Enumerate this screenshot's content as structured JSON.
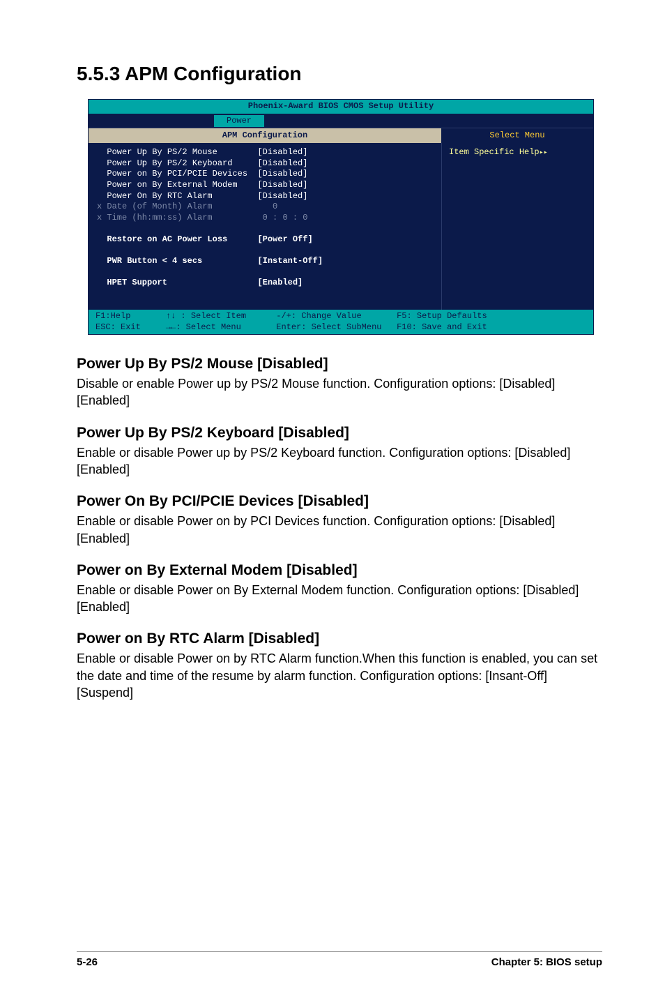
{
  "heading": "5.5.3   APM Configuration",
  "bios": {
    "title": "Phoenix-Award BIOS CMOS Setup Utility",
    "tab": "Power",
    "panel_title": "APM Configuration",
    "select_menu": "Select Menu",
    "help_title": "Item Specific Help",
    "rows": [
      {
        "prefix": "  ",
        "label": "Power Up By PS/2 Mouse",
        "value": "[Disabled]",
        "dim": false
      },
      {
        "prefix": "  ",
        "label": "Power Up By PS/2 Keyboard",
        "value": "[Disabled]",
        "dim": false
      },
      {
        "prefix": "  ",
        "label": "Power on By PCI/PCIE Devices",
        "value": "[Disabled]",
        "dim": false
      },
      {
        "prefix": "  ",
        "label": "Power on By External Modem",
        "value": "[Disabled]",
        "dim": false
      },
      {
        "prefix": "  ",
        "label": "Power On By RTC Alarm",
        "value": "[Disabled]",
        "dim": false
      },
      {
        "prefix": "x ",
        "label": "Date (of Month) Alarm",
        "value": "   0",
        "dim": true
      },
      {
        "prefix": "x ",
        "label": "Time (hh:mm:ss) Alarm",
        "value": " 0 : 0 : 0",
        "dim": true
      }
    ],
    "bold_rows": [
      {
        "label": "Restore on AC Power Loss",
        "value": "[Power Off]"
      },
      {
        "label": "PWR Button < 4 secs",
        "value": "[Instant-Off]"
      },
      {
        "label": "HPET Support",
        "value": "[Enabled]"
      }
    ],
    "footer": {
      "f1": "F1:Help",
      "updown": "↑↓ : Select Item",
      "change": "-/+: Change Value",
      "f5": "F5: Setup Defaults",
      "esc": "ESC: Exit",
      "lr": "→←: Select Menu",
      "enter": "Enter: Select SubMenu",
      "f10": "F10: Save and Exit"
    }
  },
  "sections": [
    {
      "title": "Power Up By PS/2 Mouse [Disabled]",
      "body": "Disable or enable Power up by PS/2 Mouse function. Configuration options: [Disabled] [Enabled]"
    },
    {
      "title": "Power Up By PS/2 Keyboard [Disabled]",
      "body": "Enable or disable Power up by PS/2 Keyboard function. Configuration options: [Disabled] [Enabled]"
    },
    {
      "title": "Power On By PCI/PCIE Devices [Disabled]",
      "body": "Enable or disable Power on by PCI Devices function. Configuration options: [Disabled] [Enabled]"
    },
    {
      "title": "Power on By External Modem [Disabled]",
      "body": "Enable or disable Power on By External Modem function. Configuration options: [Disabled] [Enabled]"
    },
    {
      "title": "Power on By RTC Alarm [Disabled]",
      "body": "Enable or disable Power on by RTC Alarm function.When this function is enabled, you can set the date and time of the resume by alarm function. Configuration options: [Insant-Off] [Suspend]"
    }
  ],
  "page_footer": {
    "left": "5-26",
    "right": "Chapter 5: BIOS setup"
  }
}
